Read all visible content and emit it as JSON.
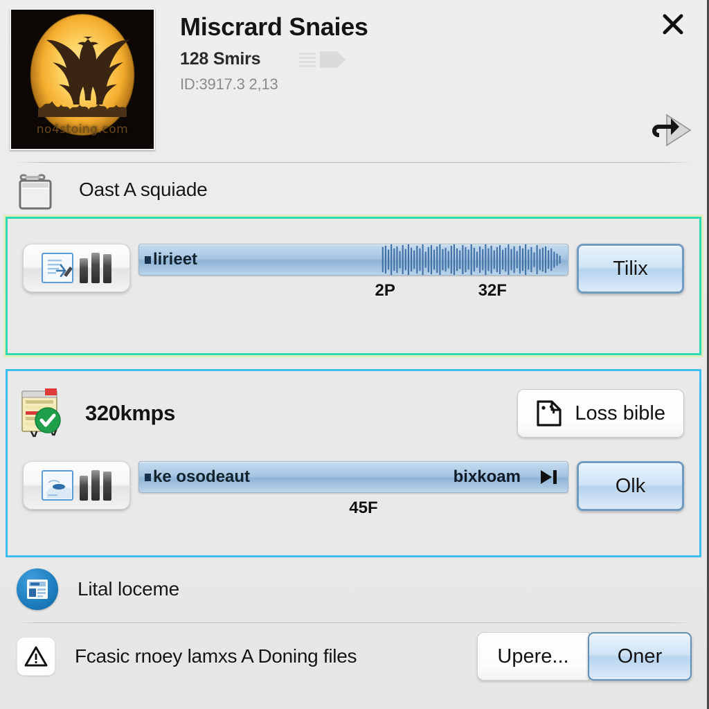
{
  "header": {
    "title": "Miscrard Snaies",
    "subtitle": "128 Smirs",
    "id_text": "ID:3917.3 2,13",
    "thumbnail_brand": "no4stoing.com",
    "close_icon": "close-icon",
    "share_icon": "share-arrow-icon",
    "ghost_icon": "document-placeholder-icon"
  },
  "section_cast": {
    "icon": "window-frame-icon",
    "label": "Oast A squiade"
  },
  "panel_green": {
    "border_color": "#2fd9b4",
    "media_button_icon": "document-chart-icon",
    "track": {
      "label_left": "lirieet",
      "waveform": "audio-waveform",
      "ticks": [
        {
          "text": "2P",
          "left_pct": 55
        },
        {
          "text": "32F",
          "left_pct": 79
        }
      ]
    },
    "action_label": "Tilix"
  },
  "panel_blue": {
    "border_color": "#3fbdf0",
    "rate": {
      "icon": "certificate-verified-icon",
      "label": "320kmps"
    },
    "secondary_button": {
      "icon": "broken-image-icon",
      "label": "Loss bible"
    },
    "media_button_icon": "image-thumbnail-icon",
    "track": {
      "label_left": "ke osodeaut",
      "label_right": "bixkoam",
      "next_icon": "skip-next-icon",
      "ticks": [
        {
          "text": "45F",
          "left_pct": 49
        }
      ]
    },
    "action_label": "Olk"
  },
  "info_row": {
    "icon": "news-card-icon",
    "label": "Lital loceme"
  },
  "footer": {
    "warning_icon": "warning-triangle-icon",
    "message": "Fcasic rnoey lamxs A Doning files",
    "secondary_label": "Upere...",
    "primary_label": "Oner"
  }
}
